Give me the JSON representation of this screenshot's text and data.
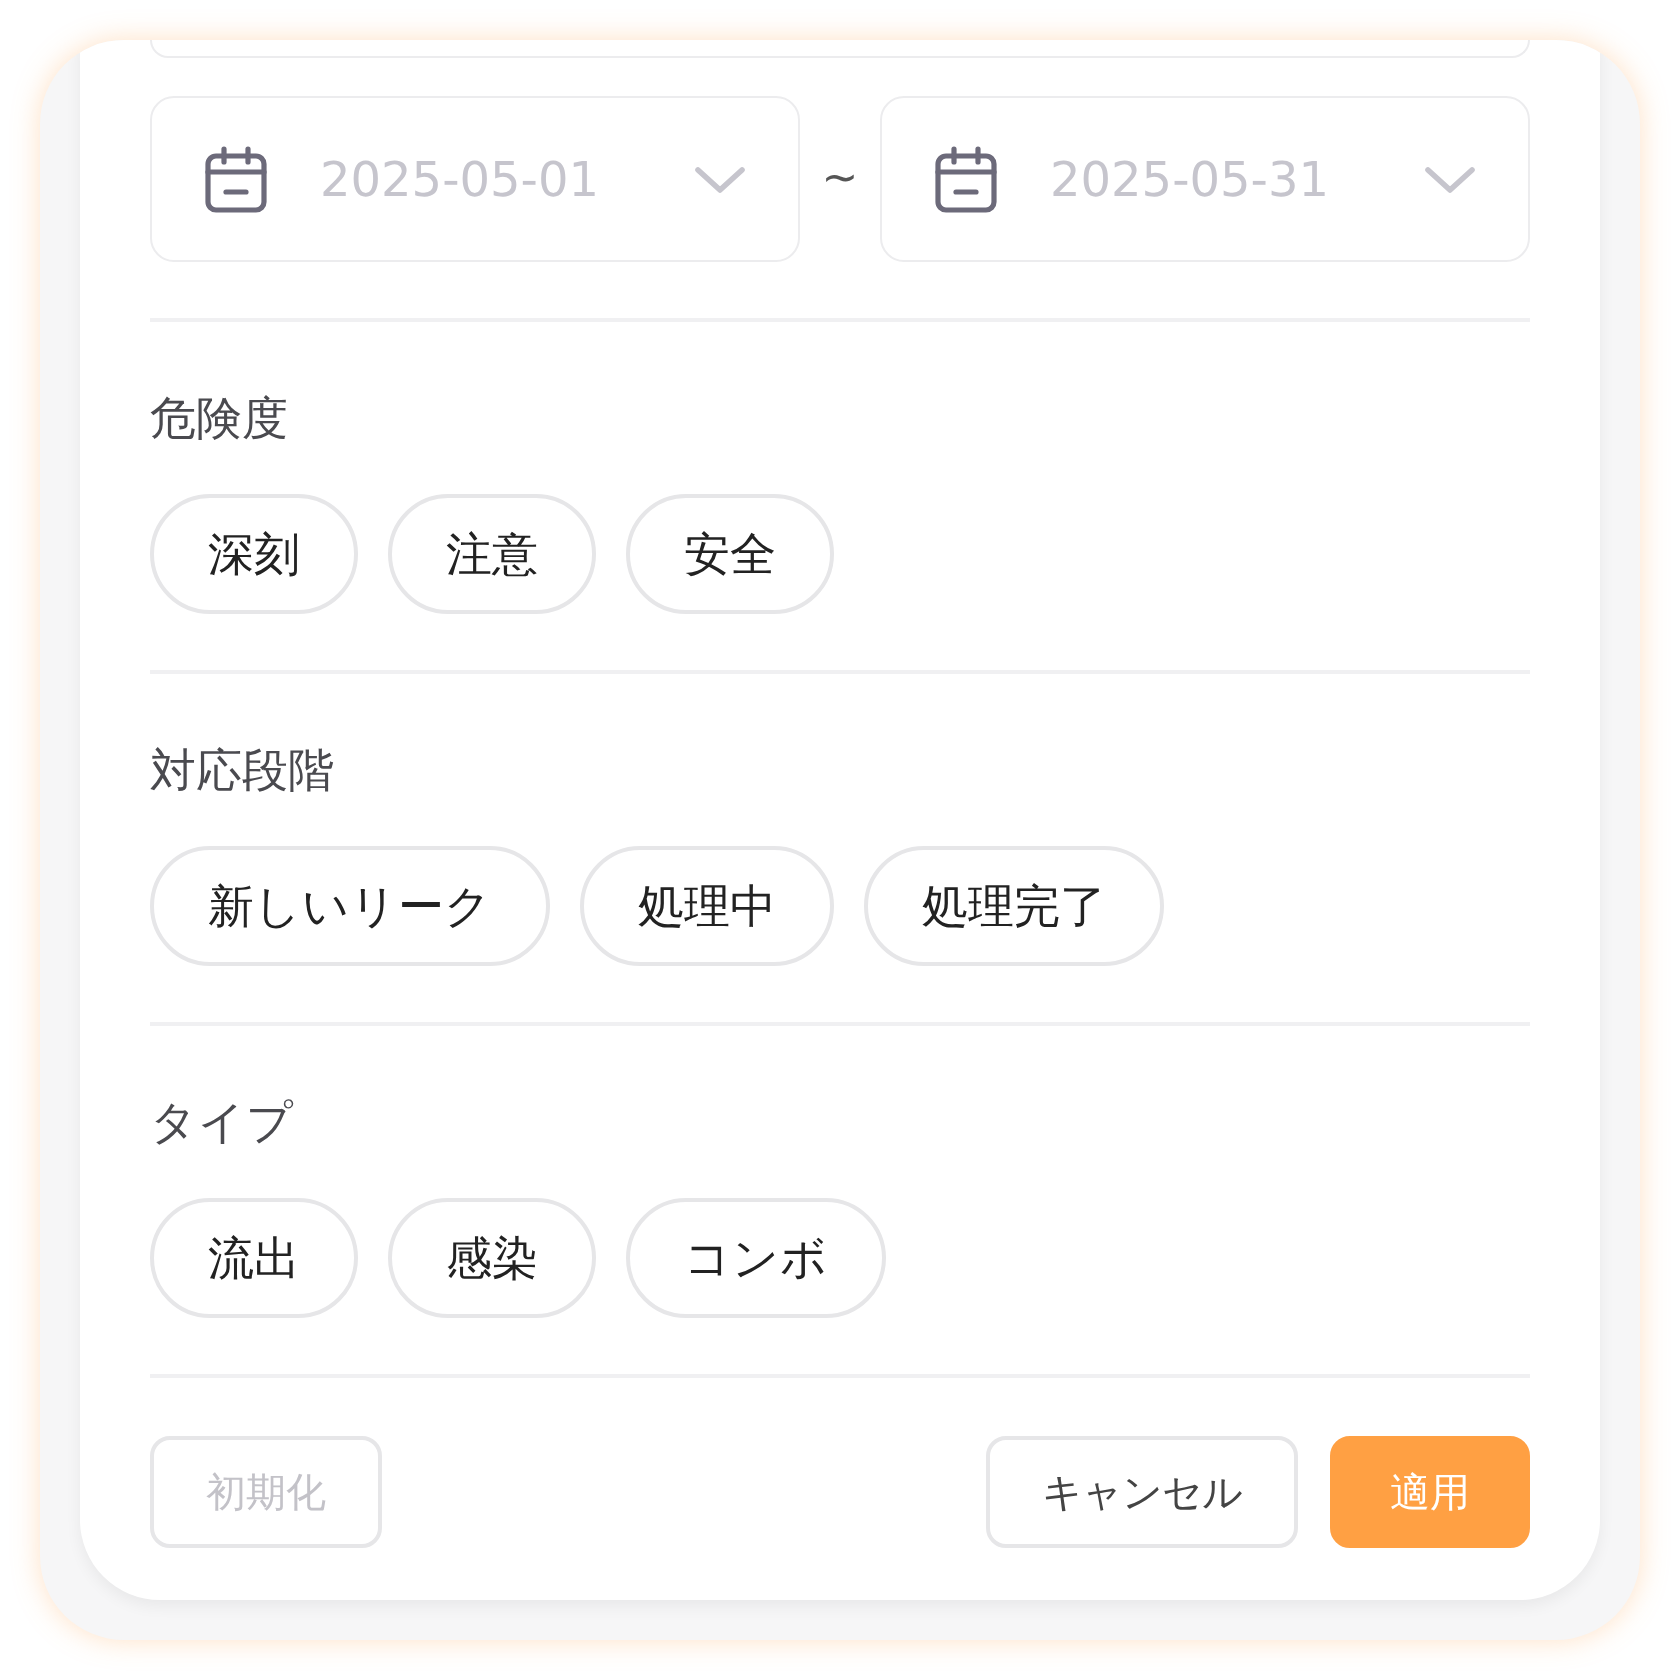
{
  "date_range": {
    "start": {
      "placeholder": "2025-05-01"
    },
    "separator": "~",
    "end": {
      "placeholder": "2025-05-31"
    }
  },
  "sections": [
    {
      "title": "危険度",
      "options": [
        {
          "label": "深刻"
        },
        {
          "label": "注意"
        },
        {
          "label": "安全"
        }
      ]
    },
    {
      "title": "対応段階",
      "options": [
        {
          "label": "新しいリーク"
        },
        {
          "label": "処理中"
        },
        {
          "label": "処理完了"
        }
      ]
    },
    {
      "title": "タイプ",
      "options": [
        {
          "label": "流出"
        },
        {
          "label": "感染"
        },
        {
          "label": "コンボ"
        }
      ]
    }
  ],
  "footer": {
    "reset": {
      "label": "初期化",
      "disabled": true
    },
    "cancel": {
      "label": "キャンセル"
    },
    "apply": {
      "label": "適用"
    }
  }
}
